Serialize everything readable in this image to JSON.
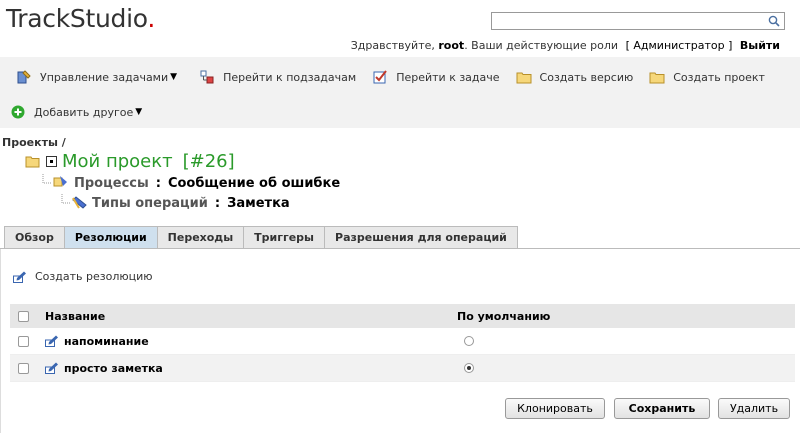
{
  "app": {
    "logo_main": "TrackStudio",
    "logo_dot": "."
  },
  "search": {
    "value": "",
    "placeholder": ""
  },
  "greeting": {
    "hello": "Здравствуйте,",
    "user": "root",
    "roles_text": ". Ваши действующие роли",
    "role": "[ Администратор ]",
    "logout": "Выйти"
  },
  "toolbar": {
    "manage_tasks": "Управление задачами",
    "go_subtasks": "Перейти к подзадачам",
    "go_task": "Перейти к задаче",
    "create_version": "Создать версию",
    "create_project": "Создать проект",
    "add_other": "Добавить другое"
  },
  "breadcrumb": "Проекты /",
  "tree": {
    "project_title": "Мой проект",
    "project_id": "[#26]",
    "process_label": "Процессы",
    "process_value": "Сообщение об ошибке",
    "optype_label": "Типы операций",
    "optype_value": "Заметка",
    "sep": ":"
  },
  "tabs": [
    {
      "label": "Обзор",
      "active": false
    },
    {
      "label": "Резолюции",
      "active": true
    },
    {
      "label": "Переходы",
      "active": false
    },
    {
      "label": "Триггеры",
      "active": false
    },
    {
      "label": "Разрешения для операций",
      "active": false
    }
  ],
  "create_resolution": "Создать резолюцию",
  "table": {
    "columns": {
      "name": "Название",
      "default": "По умолчанию"
    },
    "rows": [
      {
        "name": "напоминание",
        "default": false
      },
      {
        "name": "просто заметка",
        "default": true
      }
    ]
  },
  "buttons": {
    "clone": "Клонировать",
    "save": "Сохранить",
    "delete": "Удалить"
  },
  "colors": {
    "accent": "#2a9a2a",
    "tab_active": "#cfe0ee",
    "toolbar_bg": "#f2f2f2",
    "logo_dot": "#cc0000"
  },
  "icons": {
    "collapse": "collapse-panel-icon",
    "manage": "tools-icon",
    "subtasks": "subtasks-icon",
    "task": "checkbox-task-icon",
    "folder": "folder-icon",
    "add": "plus-circle-icon",
    "edit": "edit-pencil-icon"
  }
}
